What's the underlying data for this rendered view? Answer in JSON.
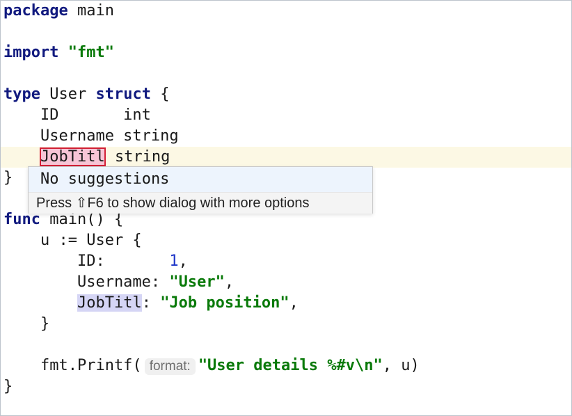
{
  "code": {
    "l1": {
      "kw": "package",
      "rest": " main"
    },
    "l3": {
      "kw": "import",
      "str": "\"fmt\""
    },
    "l5": {
      "kw1": "type",
      "mid": " User ",
      "kw2": "struct",
      "rest": " {"
    },
    "l6": {
      "text": "    ID       int"
    },
    "l7": {
      "text": "    Username string"
    },
    "l8": {
      "indent": "    ",
      "ident": "JobTitl",
      "rest": " string"
    },
    "l9": {
      "text": "}"
    },
    "l11": {
      "kw": "func",
      "rest": " main() {"
    },
    "l12": {
      "text": "    u := User {"
    },
    "l13": {
      "prefix": "        ID:       ",
      "num": "1",
      "suffix": ","
    },
    "l14": {
      "prefix": "        Username: ",
      "str": "\"User\"",
      "suffix": ","
    },
    "l15": {
      "indent": "        ",
      "ident": "JobTitl",
      "mid": ": ",
      "str": "\"Job position\"",
      "suffix": ","
    },
    "l16": {
      "text": "    }"
    },
    "l18": {
      "prefix": "    fmt.Printf(",
      "hint": "format:",
      "str": "\"User details %#v\\n\"",
      "suffix": ", u)"
    },
    "l19": {
      "text": "}"
    }
  },
  "popup": {
    "item": "No suggestions",
    "footer": "Press ⇧F6 to show dialog with more options"
  }
}
